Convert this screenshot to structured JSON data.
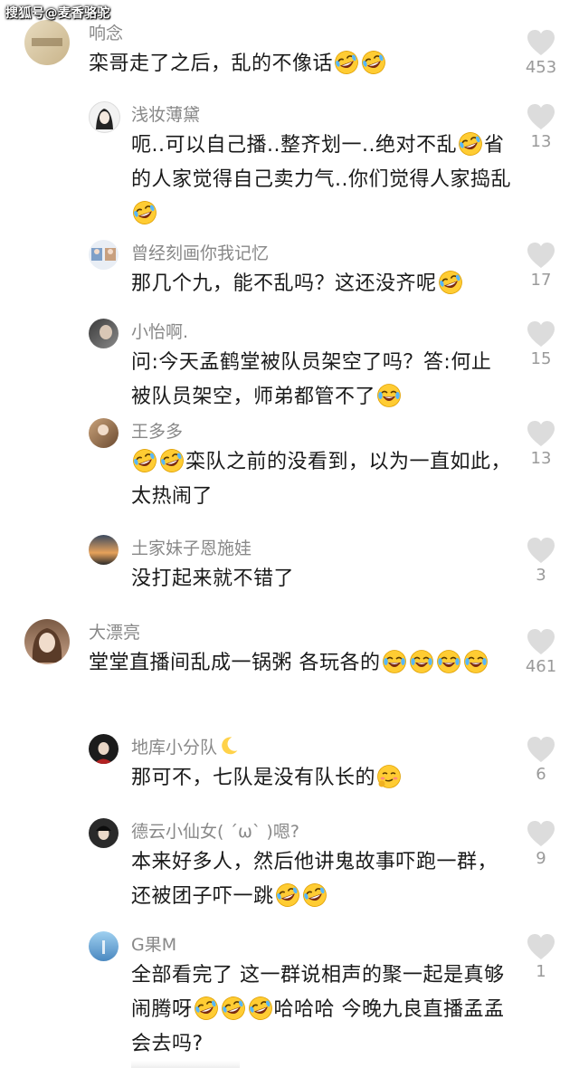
{
  "watermark": "搜狐号@麦香骆驼",
  "comments": [
    {
      "name": "响念",
      "text": "栾哥走了之后，乱的不像话",
      "emojis_after": 2,
      "likes": "453"
    },
    {
      "name": "浅妆薄黛",
      "text_parts": [
        "呃..可以自己播..整齐划一..绝对不乱",
        "省的人家觉得自己卖力气..你们觉得人家捣乱"
      ],
      "likes": "13"
    },
    {
      "name": "曾经刻画你我记忆",
      "text": "那几个九，能不乱吗？这还没齐呢",
      "likes": "17"
    },
    {
      "name": "小怡啊.",
      "text": "问:今天孟鹤堂被队员架空了吗？答:何止被队员架空，师弟都管不了",
      "likes": "15"
    },
    {
      "name": "王多多",
      "text": "栾队之前的没看到，以为一直如此，太热闹了",
      "likes": "13"
    },
    {
      "name": "土家妹子恩施娃",
      "text": "没打起来就不错了",
      "likes": "3"
    },
    {
      "name": "大漂亮",
      "text": "堂堂直播间乱成一锅粥 各玩各的",
      "likes": "461"
    },
    {
      "name": "地库小分队",
      "text": "那可不，七队是没有队长的",
      "likes": "6"
    },
    {
      "name": "德云小仙女( ´ω` )嗯?",
      "text": "本来好多人，然后他讲鬼故事吓跑一群，还被团子吓一跳",
      "likes": "9"
    },
    {
      "name": "G果M",
      "text_parts": [
        "全部看完了 这一群说相声的聚一起是真够闹腾呀",
        "哈哈哈 今晚九良直播孟孟会去吗?"
      ],
      "likes": "1"
    }
  ],
  "colors": {
    "name": "#888888",
    "text": "#1a1a1a",
    "like_icon": "#dcdcdc",
    "like_count": "#9a9a9a"
  },
  "icons": {
    "like": "heart-icon",
    "laugh": "rofl-emoji",
    "tears": "joy-tears-emoji",
    "moon": "crescent-moon-emoji",
    "shy": "shy-smile-emoji"
  }
}
